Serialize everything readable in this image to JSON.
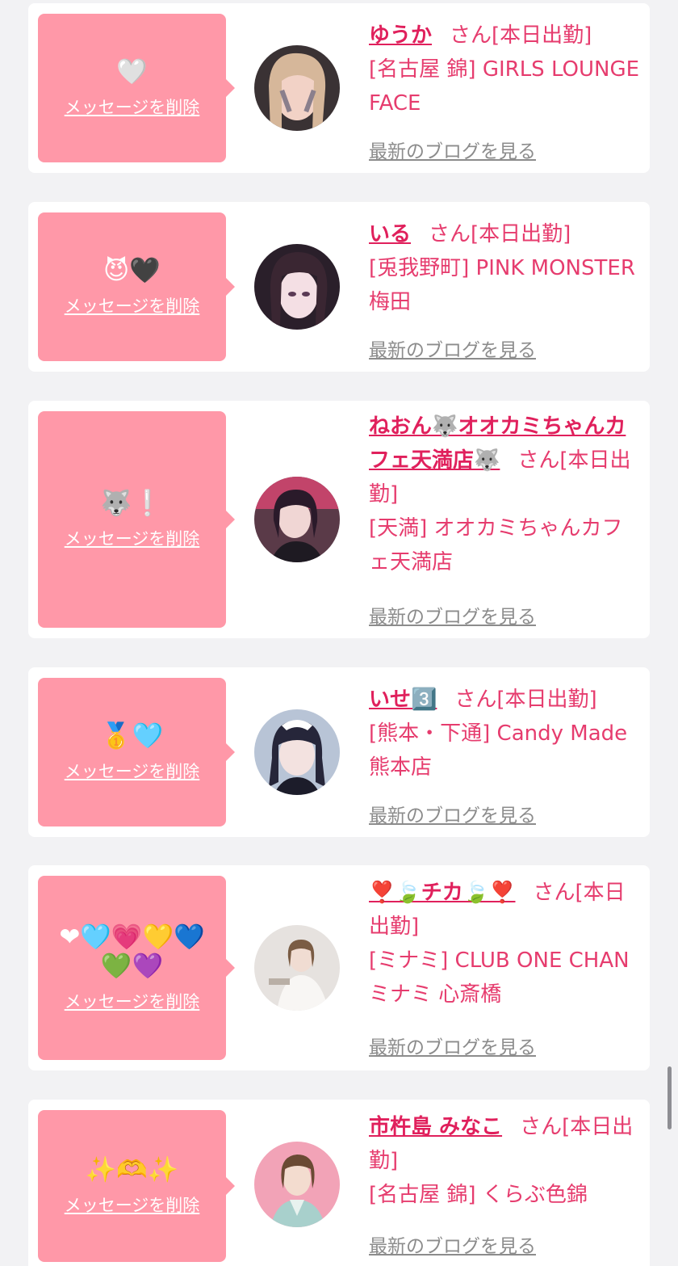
{
  "items": [
    {
      "message": "🤍",
      "delete_label": "メッセージを削除",
      "avatar_icon": "avatar-girl-1",
      "name": "ゆうか",
      "suffix": "さん[本日出勤]",
      "shop": "[名古屋 錦] GIRLS LOUNGE FACE",
      "blog_label": "最新のブログを見る"
    },
    {
      "message": "😈🖤",
      "delete_label": "メッセージを削除",
      "avatar_icon": "avatar-girl-2",
      "name": "いる",
      "suffix": "さん[本日出勤]",
      "shop": "[兎我野町] PINK MONSTER梅田",
      "blog_label": "最新のブログを見る"
    },
    {
      "message": "🐺❕",
      "delete_label": "メッセージを削除",
      "avatar_icon": "avatar-girl-3",
      "name": "ねおん🐺オオカミちゃんカフェ天満店🐺",
      "suffix": "さん[本日出勤]",
      "shop": "[天満] オオカミちゃんカフェ天満店",
      "blog_label": "最新のブログを見る"
    },
    {
      "message": "🥇🩵",
      "delete_label": "メッセージを削除",
      "avatar_icon": "avatar-girl-4",
      "name": "いせ3️⃣",
      "suffix": "さん[本日出勤]",
      "shop": "[熊本・下通] Candy Made 熊本店",
      "blog_label": "最新のブログを見る"
    },
    {
      "message": "❤🩵💗💛💙💚💜",
      "delete_label": "メッセージを削除",
      "avatar_icon": "avatar-girl-5",
      "name": "❣️🍃チカ🍃❣️",
      "suffix": "さん[本日出勤]",
      "shop": "[ミナミ] CLUB ONE CHAN ミナミ 心斎橋",
      "blog_label": "最新のブログを見る"
    },
    {
      "message": "✨🫶✨",
      "delete_label": "メッセージを削除",
      "avatar_icon": "avatar-girl-6",
      "name": "市杵島 みなこ",
      "suffix": "さん[本日出勤]",
      "shop": "[名古屋 錦] くらぶ色錦",
      "blog_label": "最新のブログを見る"
    }
  ]
}
